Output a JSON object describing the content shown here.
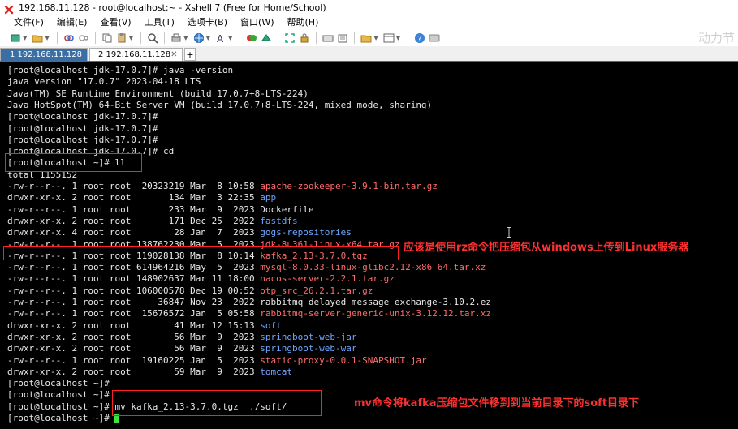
{
  "window": {
    "title": "192.168.11.128 - root@localhost:~ - Xshell 7 (Free for Home/School)"
  },
  "menu": [
    "文件(F)",
    "编辑(E)",
    "查看(V)",
    "工具(T)",
    "选项卡(B)",
    "窗口(W)",
    "帮助(H)"
  ],
  "watermark": "动力节",
  "tabs": [
    {
      "label": "1 192.168.11.128",
      "active": true
    },
    {
      "label": "2 192.168.11.128",
      "active": false
    }
  ],
  "tab_add": "+",
  "terminal": {
    "lines": [
      [
        {
          "t": "[root@localhost jdk-17.0.7]# java -version"
        }
      ],
      [
        {
          "t": "java version \"17.0.7\" 2023-04-18 LTS"
        }
      ],
      [
        {
          "t": "Java(TM) SE Runtime Environment (build 17.0.7+8-LTS-224)"
        }
      ],
      [
        {
          "t": "Java HotSpot(TM) 64-Bit Server VM (build 17.0.7+8-LTS-224, mixed mode, sharing)"
        }
      ],
      [
        {
          "t": "[root@localhost jdk-17.0.7]#"
        }
      ],
      [
        {
          "t": "[root@localhost jdk-17.0.7]#"
        }
      ],
      [
        {
          "t": "[root@localhost jdk-17.0.7]#"
        }
      ],
      [
        {
          "t": "[root@localhost jdk-17.0.7]# cd"
        }
      ],
      [
        {
          "t": "[root@localhost ~]# ll"
        }
      ],
      [
        {
          "t": "total 1155152"
        }
      ],
      [
        {
          "t": "-rw-r--r--. 1 root root  20323219 Mar  8 10:58 "
        },
        {
          "t": "apache-zookeeper-3.9.1-bin.tar.gz",
          "c": "f"
        }
      ],
      [
        {
          "t": "drwxr-xr-x. 2 root root       134 Mar  3 22:35 "
        },
        {
          "t": "app",
          "c": "d"
        }
      ],
      [
        {
          "t": "-rw-r--r--. 1 root root       233 Mar  9  2023 Dockerfile"
        }
      ],
      [
        {
          "t": "drwxr-xr-x. 2 root root       171 Dec 25  2022 "
        },
        {
          "t": "fastdfs",
          "c": "d"
        }
      ],
      [
        {
          "t": "drwxr-xr-x. 4 root root        28 Jan  7  2023 "
        },
        {
          "t": "gogs-repositories",
          "c": "d"
        }
      ],
      [
        {
          "t": "-rw-r--r--. 1 root root 138762230 Mar  5  2023 "
        },
        {
          "t": "jdk-8u361-linux-x64.tar.gz",
          "c": "f"
        }
      ],
      [
        {
          "t": "-rw-r--r--. 1 root root 119028138 Mar  8 10:14 "
        },
        {
          "t": "kafka_2.13-3.7.0.tgz",
          "c": "f"
        }
      ],
      [
        {
          "t": "-rw-r--r--. 1 root root 614964216 May  5  2023 "
        },
        {
          "t": "mysql-8.0.33-linux-glibc2.12-x86_64.tar.xz",
          "c": "f"
        }
      ],
      [
        {
          "t": "-rw-r--r--. 1 root root 148902637 Mar 11 18:00 "
        },
        {
          "t": "nacos-server-2.2.1.tar.gz",
          "c": "f"
        }
      ],
      [
        {
          "t": "-rw-r--r--. 1 root root 106000578 Dec 19 00:52 "
        },
        {
          "t": "otp_src_26.2.1.tar.gz",
          "c": "f"
        }
      ],
      [
        {
          "t": "-rw-r--r--. 1 root root     36847 Nov 23  2022 rabbitmq_delayed_message_exchange-3.10.2.ez"
        }
      ],
      [
        {
          "t": "-rw-r--r--. 1 root root  15676572 Jan  5 05:58 "
        },
        {
          "t": "rabbitmq-server-generic-unix-3.12.12.tar.xz",
          "c": "f"
        }
      ],
      [
        {
          "t": "drwxr-xr-x. 2 root root        41 Mar 12 15:13 "
        },
        {
          "t": "soft",
          "c": "d"
        }
      ],
      [
        {
          "t": "drwxr-xr-x. 2 root root        56 Mar  9  2023 "
        },
        {
          "t": "springboot-web-jar",
          "c": "d"
        }
      ],
      [
        {
          "t": "drwxr-xr-x. 2 root root        56 Mar  9  2023 "
        },
        {
          "t": "springboot-web-war",
          "c": "d"
        }
      ],
      [
        {
          "t": "-rw-r--r--. 1 root root  19160225 Jan  5  2023 "
        },
        {
          "t": "static-proxy-0.0.1-SNAPSHOT.jar",
          "c": "f"
        }
      ],
      [
        {
          "t": "drwxr-xr-x. 2 root root        59 Mar  9  2023 "
        },
        {
          "t": "tomcat",
          "c": "d"
        }
      ],
      [
        {
          "t": "[root@localhost ~]#"
        }
      ],
      [
        {
          "t": "[root@localhost ~]#"
        }
      ],
      [
        {
          "t": "[root@localhost ~]# mv kafka_2.13-3.7.0.tgz  ./soft/"
        }
      ],
      [
        {
          "t": "[root@localhost ~]# "
        }
      ]
    ]
  },
  "annotations": {
    "upload_note": "应该是使用rz命令把压缩包从windows上传到Linux服务器",
    "mv_note": "mv命令将kafka压缩包文件移到到当前目录下的soft目录下"
  }
}
